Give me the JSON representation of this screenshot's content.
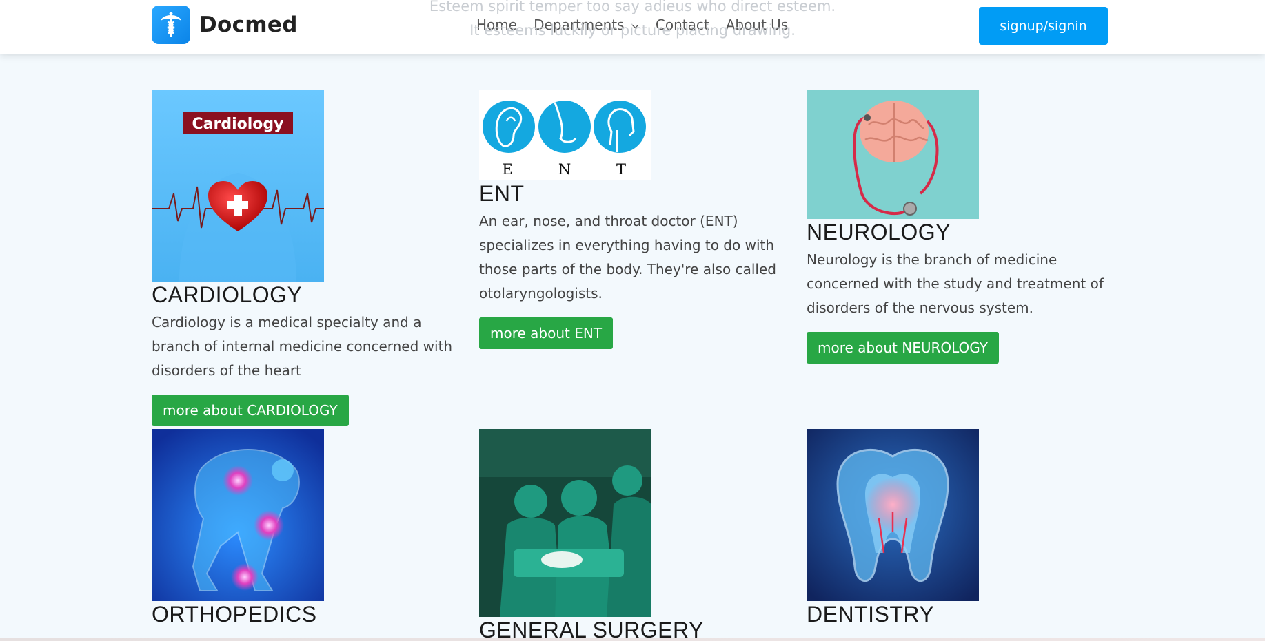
{
  "header": {
    "brand": "Docmed",
    "nav": [
      "Home",
      "Departments",
      "Contact",
      "About Us"
    ],
    "signup_label": "signup/signin",
    "ghost_text_line1": "Esteem spirit temper too say adieus who direct esteem.",
    "ghost_text_line2": "It esteems luckily or picture placing drawing."
  },
  "colors": {
    "primary": "#019cf5",
    "success": "#28a745",
    "background": "#f3f9fd"
  },
  "departments": [
    {
      "title": "CARDIOLOGY",
      "description": "Cardiology is a medical specialty and a branch of internal medicine concerned with disorders of the heart",
      "button": "more about CARDIOLOGY",
      "image_label": "Cardiology"
    },
    {
      "title": "ENT",
      "description": "An ear, nose, and throat doctor (ENT) specializes in everything having to do with those parts of the body. They're also called otolaryngologists.",
      "button": "more about ENT",
      "image_letters": [
        "E",
        "N",
        "T"
      ]
    },
    {
      "title": "NEUROLOGY",
      "description": "Neurology is the branch of medicine concerned with the study and treatment of disorders of the nervous system.",
      "button": "more about NEUROLOGY"
    },
    {
      "title": "ORTHOPEDICS"
    },
    {
      "title": "GENERAL SURGERY"
    },
    {
      "title": "DENTISTRY"
    }
  ]
}
